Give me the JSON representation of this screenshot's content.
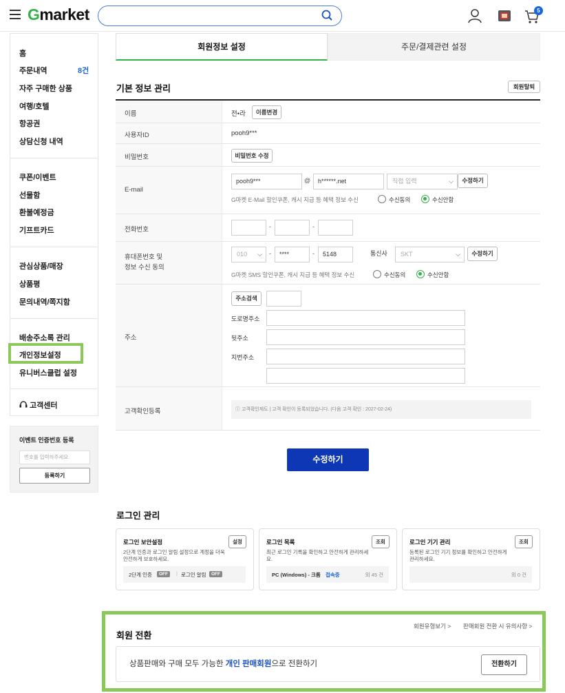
{
  "header": {
    "logo_g": "G",
    "logo_rest": "market",
    "search": {
      "placeholder": "",
      "value": ""
    },
    "cart_count": "5"
  },
  "sidebar": {
    "group1": [
      {
        "label": "홈"
      },
      {
        "label": "주문내역",
        "count": "8건"
      },
      {
        "label": "자주 구매한 상품"
      },
      {
        "label": "여행/호텔"
      },
      {
        "label": "항공권"
      },
      {
        "label": "상담신청 내역"
      }
    ],
    "group2": [
      {
        "label": "쿠폰/이벤트"
      },
      {
        "label": "선물함"
      },
      {
        "label": "환불예정금"
      },
      {
        "label": "기프트카드"
      }
    ],
    "group3": [
      {
        "label": "관심상품/매장"
      },
      {
        "label": "상품평"
      },
      {
        "label": "문의내역/쪽지함"
      }
    ],
    "group4": [
      {
        "label": "배송주소록 관리"
      },
      {
        "label": "개인정보설정"
      },
      {
        "label": "유니버스클럽 설정"
      }
    ],
    "customer_center": "고객센터"
  },
  "event": {
    "title": "이벤트 인증번호 등록",
    "input_placeholder": "번호를 입력하주세요.",
    "register_button": "등록하기"
  },
  "tabs": [
    {
      "label": "회원정보 설정",
      "active": true
    },
    {
      "label": "주문/결제관련 설정",
      "active": false
    }
  ],
  "basic_info": {
    "title": "기본 정보 관리",
    "withdraw_button": "회원탈퇴",
    "name": {
      "label": "이름",
      "value": "전•라",
      "button": "이름변경"
    },
    "user_id": {
      "label": "사용자ID",
      "value": "pooh9***"
    },
    "password": {
      "label": "비밀번호",
      "button": "비밀번호 수정"
    },
    "email": {
      "label": "E-mail",
      "local": "pooh9***",
      "at": "@",
      "domain": "h******.net",
      "domain_select": "직접 입력",
      "button": "수정하기",
      "hint": "G마켓 E-Mail 할인쿠폰, 캐시 지급 등 혜택 정보 수신",
      "agree": "수신동의",
      "disagree": "수신안함",
      "selected": "disagree"
    },
    "phone": {
      "label": "전화번호",
      "dash": "-"
    },
    "mobile": {
      "label_line1": "휴대폰번호 및",
      "label_line2": "정보 수신 동의",
      "prefix": "010",
      "middle": "****",
      "last": "5148",
      "carrier_label": "통신사",
      "carrier": "SKT",
      "button": "수정하기",
      "hint": "G마켓 SMS 할인쿠폰, 캐시 지급 등 혜택 정보 수신",
      "agree": "수신동의",
      "disagree": "수신안함",
      "selected": "disagree"
    },
    "address": {
      "label": "주소",
      "search_button": "주소검색",
      "road_label": "도로명주소",
      "detail_label": "뒷주소",
      "lot_label": "지번주소"
    },
    "verify": {
      "label": "고객확인등록",
      "text": "ⓘ 고객확인제도 | 고객 확인이 등록되었습니다. (다음 고객 확인 : 2027-02-24)"
    },
    "submit": "수정하기"
  },
  "login": {
    "title": "로그인 관리",
    "cards": [
      {
        "title": "로그인 보안설정",
        "button": "설정",
        "desc": "2단계 인증과 로그인 알림 설정으로 계정을 더욱 안전하게 보호하세요.",
        "item1": "2단계 인증",
        "item1_status": "OFF",
        "item2": "로그인 알림",
        "item2_status": "OFF"
      },
      {
        "title": "로그인 목록",
        "button": "조회",
        "desc": "최근 로그인 기록을 확인하고 안전하게 관리하세요.",
        "device": "PC (Windows) - 크롬",
        "status": "접속중",
        "count": "외 45 건"
      },
      {
        "title": "로그인 기기 관리",
        "button": "조회",
        "desc": "등록된 로그인 기기 정보를 확인하고 안전하게 관리하세요.",
        "count": "외 0 건"
      }
    ]
  },
  "conversion": {
    "title": "회원 전환",
    "link1": "회원유형보기 >",
    "link2": "판매회원 전환 시 유의사항 >",
    "text_pre": "상품판매와 구매 모두 가능한 ",
    "text_highlight": "개인 판매회원",
    "text_post": "으로 전환하기",
    "button": "전환하기"
  },
  "colors": {
    "brand_green": "#36b04a",
    "primary_blue": "#0d37b4",
    "highlight_box": "#8cc75a",
    "link_blue": "#1a66d8"
  }
}
